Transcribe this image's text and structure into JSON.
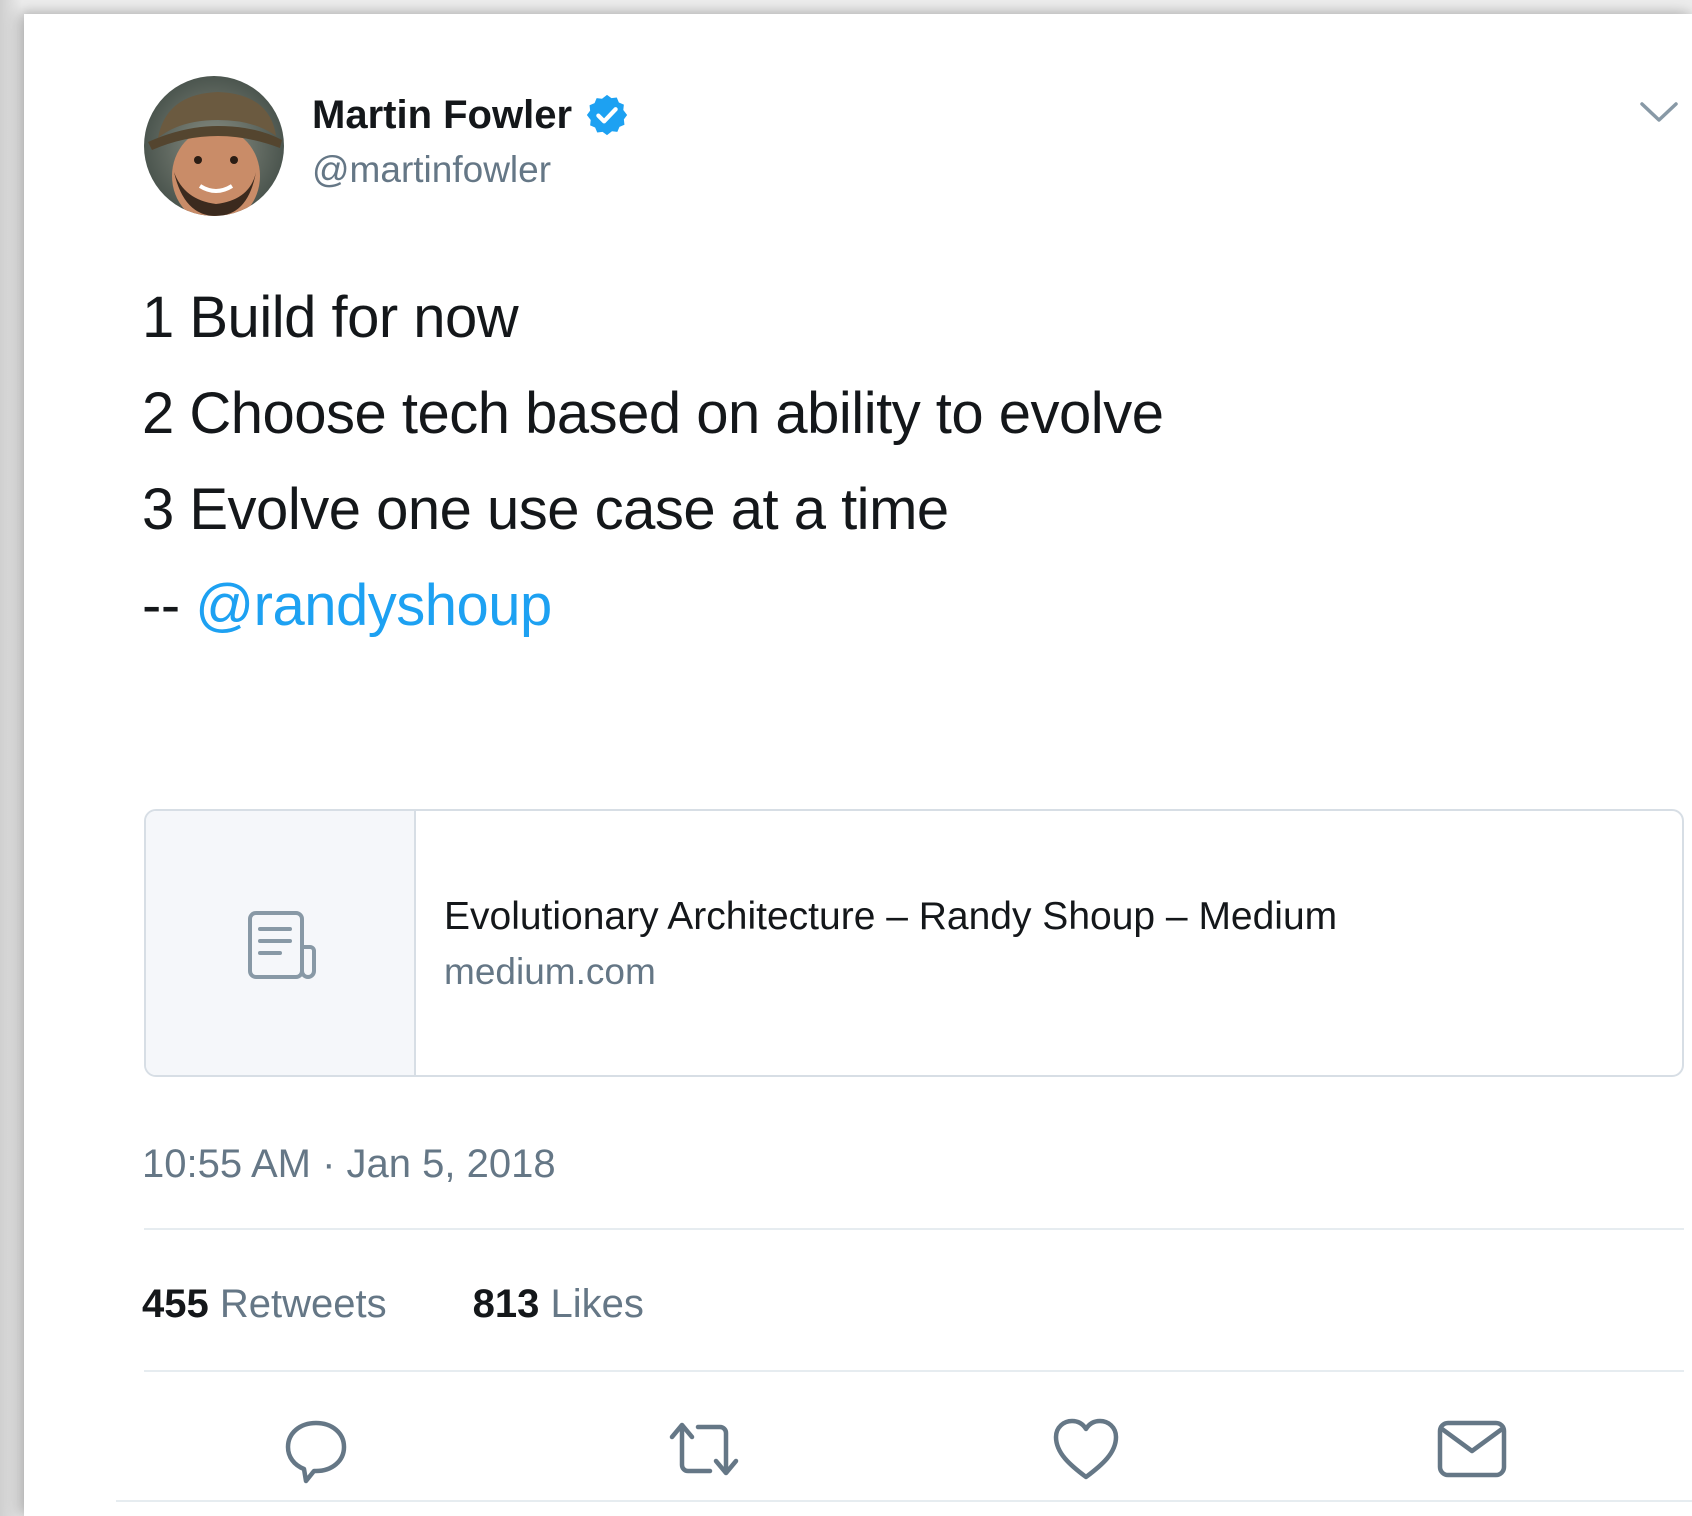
{
  "author": {
    "name": "Martin Fowler",
    "handle": "@martinfowler",
    "verified": true
  },
  "tweet": {
    "lines": [
      "1 Build for now",
      "2 Choose tech based on ability to evolve",
      "3 Evolve one use case at a time"
    ],
    "attribution_prefix": "-- ",
    "mention": "@randyshoup"
  },
  "link_card": {
    "title": "Evolutionary Architecture – Randy Shoup – Medium",
    "domain": "medium.com",
    "icon": "document-icon"
  },
  "timestamp": "10:55 AM · Jan 5, 2018",
  "stats": {
    "retweets_count": "455",
    "retweets_label": "Retweets",
    "likes_count": "813",
    "likes_label": "Likes"
  },
  "actions": [
    "reply-icon",
    "retweet-icon",
    "like-icon",
    "message-icon"
  ],
  "colors": {
    "accent": "#1da1f2",
    "text": "#14171a",
    "muted": "#657786",
    "border": "#d7dee5"
  }
}
